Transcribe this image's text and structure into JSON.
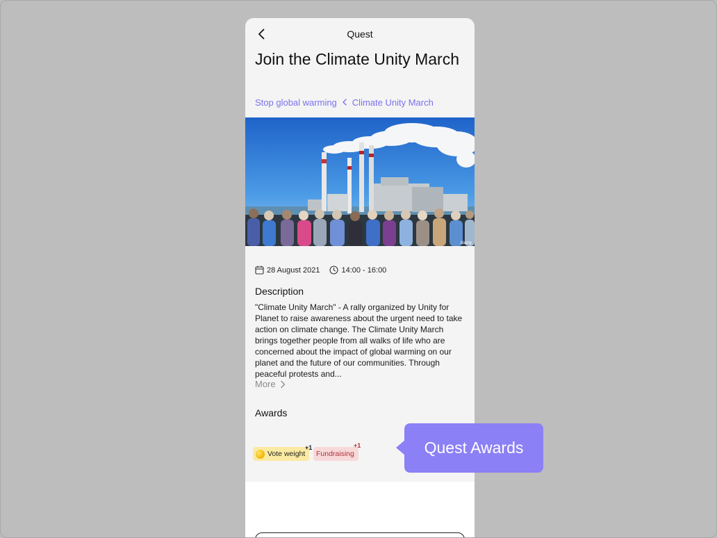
{
  "topbar": {
    "title": "Quest"
  },
  "page": {
    "title": "Join the Climate Unity March"
  },
  "breadcrumb": {
    "parent": "Stop global warming",
    "current": "Climate Unity March"
  },
  "hero": {
    "watermark": "Alamy"
  },
  "meta": {
    "date": "28 August 2021",
    "time": "14:00 - 16:00"
  },
  "description": {
    "heading": "Description",
    "text": "\"Climate Unity March\" - A rally organized by Unity for Planet to raise awareness about the urgent need to take action on climate change. The Climate Unity March brings together people from all walks of life who are concerned about the impact of global warming on our planet and the future of our communities. Through peaceful protests and...",
    "more_label": "More"
  },
  "awards": {
    "heading": "Awards",
    "items": [
      {
        "label": "Vote weight",
        "bonus": "+1",
        "color": "#fbeaa2"
      },
      {
        "label": "Fundraising",
        "bonus": "+1",
        "color": "#f8d9d9"
      }
    ]
  },
  "tooltip": {
    "label": "Quest Awards",
    "color": "#8b80f5"
  },
  "colors": {
    "accent": "#7b71ee",
    "background": "#bdbdbd",
    "card": "#f4f4f4"
  }
}
